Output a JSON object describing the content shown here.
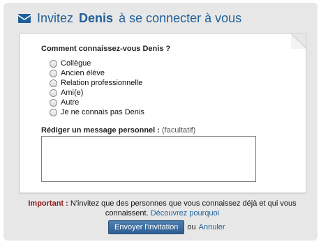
{
  "header": {
    "title_prefix": "Invitez",
    "name": "Denis",
    "title_suffix": "à se connecter à vous",
    "icon": "envelope-icon"
  },
  "form": {
    "question": "Comment connaissez-vous Denis ?",
    "options": [
      "Collègue",
      "Ancien élève",
      "Relation professionnelle",
      "Ami(e)",
      "Autre",
      "Je ne connais pas Denis"
    ],
    "message_label": "Rédiger un message personnel :",
    "message_optional": "(facultatif)",
    "message_value": ""
  },
  "notice": {
    "important_label": "Important :",
    "text": "N'invitez que des personnes que vous connaissez déjà et qui vous connaissent.",
    "link": "Découvrez pourquoi"
  },
  "actions": {
    "submit": "Envoyer l'invitation",
    "or": "ou",
    "cancel": "Annuler"
  },
  "colors": {
    "accent": "#1f5f99",
    "warning": "#8d1616",
    "button": "#3f6fa3"
  }
}
